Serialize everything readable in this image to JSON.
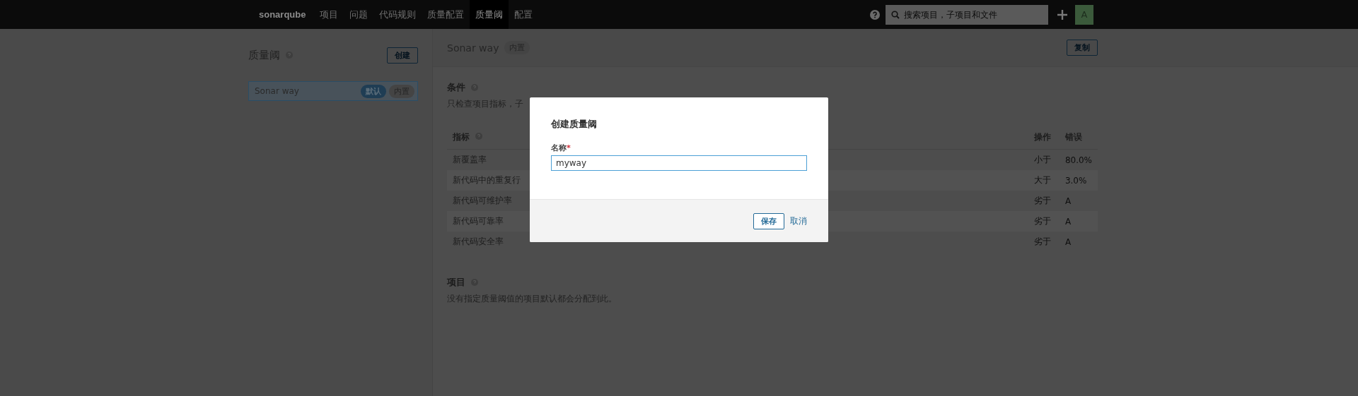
{
  "topbar": {
    "logo": "sonarqube",
    "nav": [
      {
        "label": "项目",
        "selected": false
      },
      {
        "label": "问题",
        "selected": false
      },
      {
        "label": "代码规则",
        "selected": false
      },
      {
        "label": "质量配置",
        "selected": false
      },
      {
        "label": "质量阈",
        "selected": true
      },
      {
        "label": "配置",
        "selected": false
      }
    ],
    "search": {
      "placeholder": "搜索项目，子项目和文件"
    },
    "avatar": "A"
  },
  "sidebar": {
    "title": "质量阈",
    "create_button": "创建",
    "items": [
      {
        "name": "Sonar way",
        "selected": true,
        "badges": [
          {
            "label": "默认",
            "kind": "default"
          },
          {
            "label": "内置",
            "kind": "builtin"
          }
        ]
      }
    ]
  },
  "main": {
    "title": "Sonar way",
    "badge": "内置",
    "copy_button": "复制",
    "conditions": {
      "title": "条件",
      "description": "只检查项目指标，子",
      "columns": [
        "指标",
        "操作",
        "错误"
      ],
      "rows": [
        {
          "metric": "新覆盖率",
          "operator": "小于",
          "error": "80.0%"
        },
        {
          "metric": "新代码中的重复行",
          "operator": "大于",
          "error": "3.0%"
        },
        {
          "metric": "新代码可维护率",
          "operator": "劣于",
          "error": "A"
        },
        {
          "metric": "新代码可靠率",
          "operator": "劣于",
          "error": "A"
        },
        {
          "metric": "新代码安全率",
          "operator": "劣于",
          "error": "A"
        }
      ]
    },
    "projects": {
      "title": "项目",
      "description": "没有指定质量阈值的项目默认都会分配到此。"
    }
  },
  "dialog": {
    "title": "创建质量阈",
    "field_label": "名称",
    "required_mark": "*",
    "value": "myway",
    "save_button": "保存",
    "cancel_link": "取消"
  }
}
